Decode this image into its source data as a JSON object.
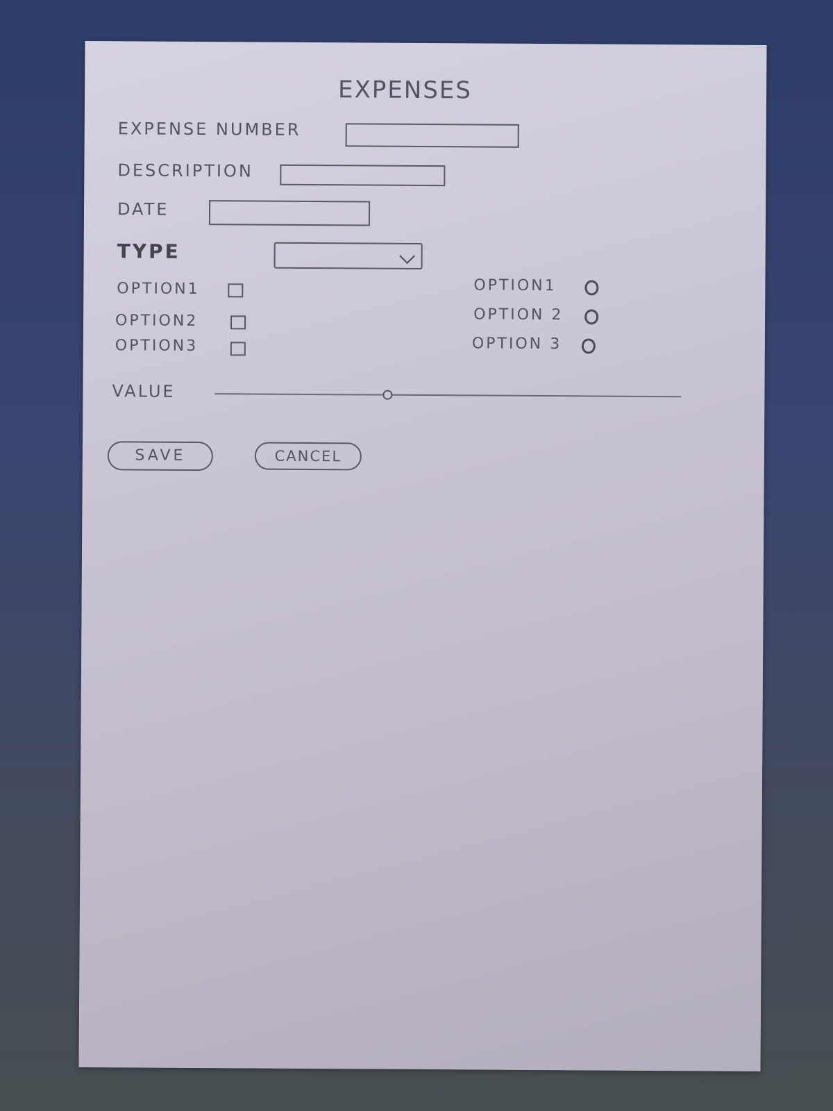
{
  "form": {
    "title": "EXPENSES",
    "fields": {
      "expense_number_label": "EXPENSE NUMBER",
      "description_label": "DESCRIPTION",
      "date_label": "DATE",
      "type_label": "TYPE"
    },
    "checkboxes": [
      {
        "label": "OPTION1"
      },
      {
        "label": "OPTION2"
      },
      {
        "label": "OPTION3"
      }
    ],
    "radios": [
      {
        "label": "OPTION1"
      },
      {
        "label": "OPTION 2"
      },
      {
        "label": "OPTION 3"
      }
    ],
    "value": {
      "label": "VALUE",
      "level_fraction": 0.37
    },
    "buttons": {
      "save_label": "SAVE",
      "cancel_label": "CANCEL"
    }
  }
}
